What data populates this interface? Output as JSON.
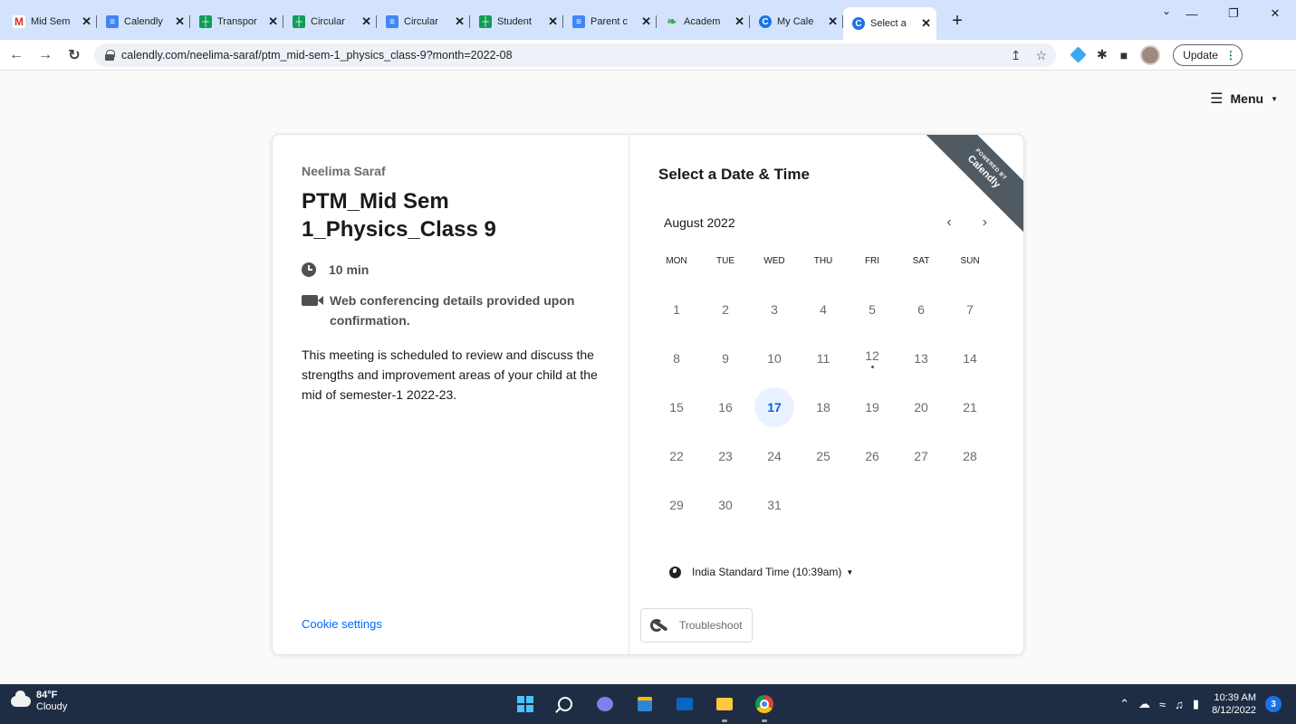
{
  "browser": {
    "tabs": [
      {
        "title": "Mid Sem",
        "favicon": "gmail-icon",
        "active": false
      },
      {
        "title": "Calendly",
        "favicon": "docs-icon",
        "active": false
      },
      {
        "title": "Transpor",
        "favicon": "sheets-icon",
        "active": false
      },
      {
        "title": "Circular",
        "favicon": "sheets-icon",
        "active": false
      },
      {
        "title": "Circular",
        "favicon": "docs-icon",
        "active": false
      },
      {
        "title": "Student",
        "favicon": "sheets-icon",
        "active": false
      },
      {
        "title": "Parent c",
        "favicon": "docs-icon",
        "active": false
      },
      {
        "title": "Academ",
        "favicon": "academics-icon",
        "active": false
      },
      {
        "title": "My Cale",
        "favicon": "calendly-icon",
        "active": false
      },
      {
        "title": "Select a",
        "favicon": "calendly-icon",
        "active": true
      }
    ],
    "url": "calendly.com/neelima-saraf/ptm_mid-sem-1_physics_class-9?month=2022-08",
    "update_label": "Update"
  },
  "page": {
    "menu_label": "Menu",
    "organizer": "Neelima Saraf",
    "event_title": "PTM_Mid Sem 1_Physics_Class 9",
    "duration": "10 min",
    "location": "Web conferencing details provided upon confirmation.",
    "description": "This meeting is scheduled to review and discuss the strengths and improvement areas of your child at the mid of semester-1 2022-23.",
    "cookie_settings": "Cookie settings",
    "select_title": "Select a Date & Time",
    "ribbon_small": "POWERED BY",
    "ribbon_brand": "Calendly",
    "month": "August 2022",
    "weekdays": [
      "MON",
      "TUE",
      "WED",
      "THU",
      "FRI",
      "SAT",
      "SUN"
    ],
    "days": [
      "1",
      "2",
      "3",
      "4",
      "5",
      "6",
      "7",
      "8",
      "9",
      "10",
      "11",
      "12",
      "13",
      "14",
      "15",
      "16",
      "17",
      "18",
      "19",
      "20",
      "21",
      "22",
      "23",
      "24",
      "25",
      "26",
      "27",
      "28",
      "29",
      "30",
      "31"
    ],
    "today_day": "12",
    "selected_day": "17",
    "timezone": "India Standard Time (10:39am)",
    "troubleshoot": "Troubleshoot"
  },
  "taskbar": {
    "temperature": "84°F",
    "weather": "Cloudy",
    "time": "10:39 AM",
    "date": "8/12/2022",
    "notifications": "3"
  }
}
